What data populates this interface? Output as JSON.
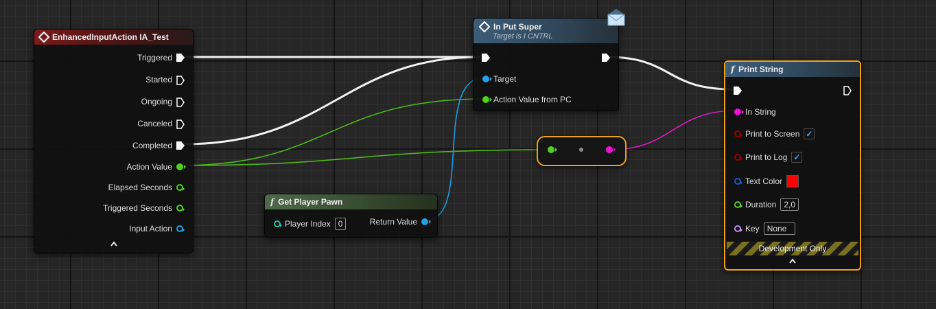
{
  "event_node": {
    "title": "EnhancedInputAction IA_Test",
    "pins": [
      "Triggered",
      "Started",
      "Ongoing",
      "Canceled",
      "Completed",
      "Action Value",
      "Elapsed Seconds",
      "Triggered Seconds",
      "Input Action"
    ],
    "collapse_icon": "chevron-up-icon"
  },
  "interface_node": {
    "title": "In Put Super",
    "subtitle": "Target is I CNTRL",
    "pins": [
      "Target",
      "Action Value from PC"
    ],
    "badge_icon": "envelope-icon"
  },
  "get_pawn_node": {
    "title": "Get Player Pawn",
    "input_label": "Player Index",
    "input_value": "0",
    "output_label": "Return Value"
  },
  "print_node": {
    "title": "Print String",
    "in_string": "In String",
    "print_to_screen": "Print to Screen",
    "print_to_log": "Print to Log",
    "text_color": "Text Color",
    "text_color_value": "#ff0000",
    "duration_label": "Duration",
    "duration_value": "2,0",
    "key_label": "Key",
    "key_value": "None",
    "dev_only": "Development Only",
    "check_mark": "✓"
  },
  "colors": {
    "exec": "#ffffff",
    "vector_pin": "#4fd11f",
    "object_pin": "#1da2e6",
    "string_pin": "#f010d8",
    "selection": "#f0a020"
  }
}
